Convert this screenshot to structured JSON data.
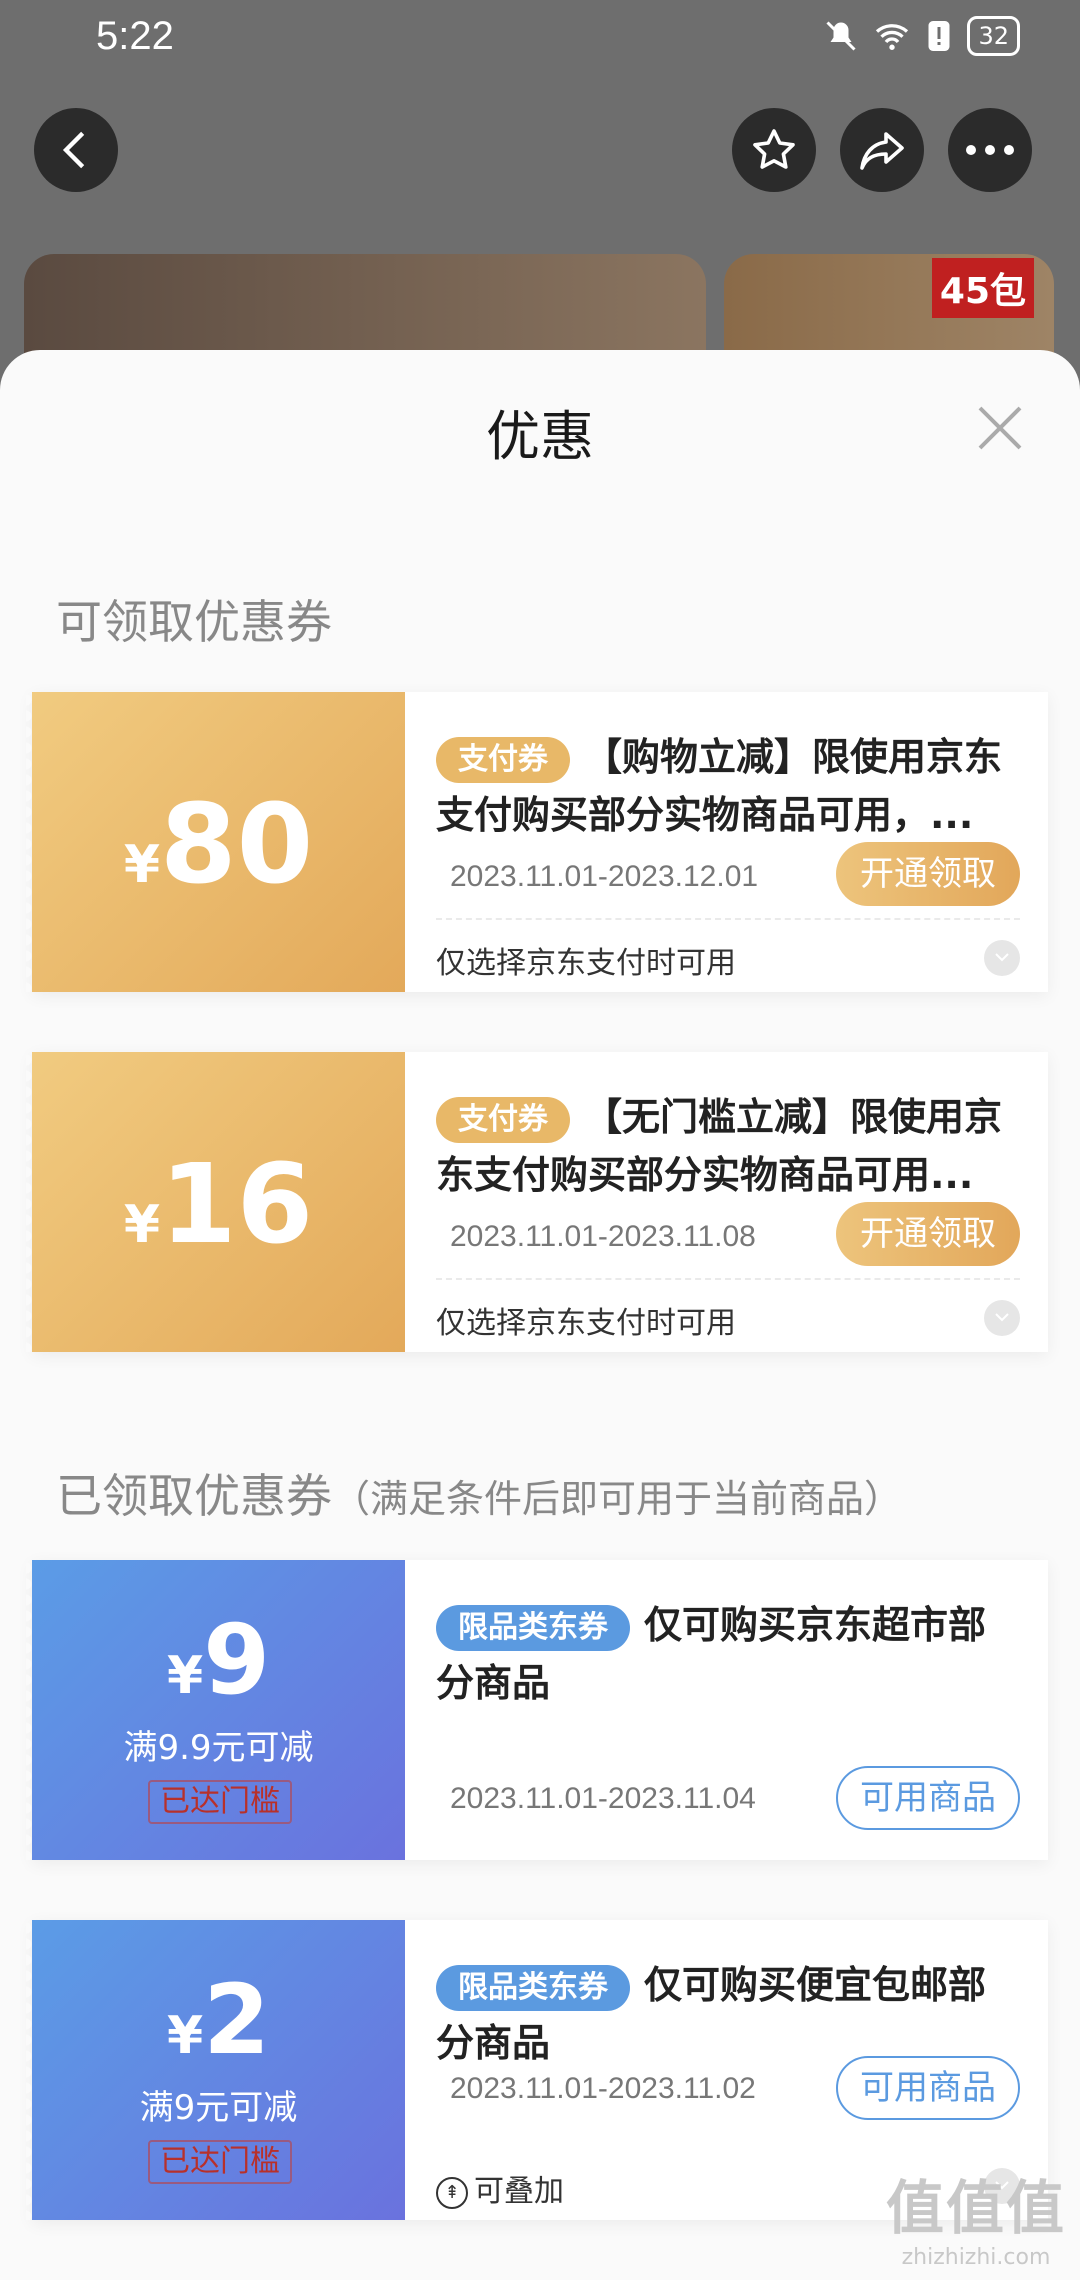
{
  "status_bar": {
    "time": "5:22",
    "battery": "32"
  },
  "preview": {
    "badge": "45包"
  },
  "sheet": {
    "title": "优惠"
  },
  "available": {
    "heading": "可领取优惠券",
    "coupons": [
      {
        "currency": "¥",
        "amount": "80",
        "badge": "支付券",
        "title": "【购物立减】限使用京东支付购买部分实物商品可用，...",
        "date": "2023.11.01-2023.12.01",
        "button": "开通领取",
        "note": "仅选择京东支付时可用"
      },
      {
        "currency": "¥",
        "amount": "16",
        "badge": "支付券",
        "title": "【无门槛立减】限使用京东支付购买部分实物商品可用...",
        "date": "2023.11.01-2023.11.08",
        "button": "开通领取",
        "note": "仅选择京东支付时可用"
      }
    ]
  },
  "claimed": {
    "heading": "已领取优惠券",
    "subheading": "（满足条件后即可用于当前商品）",
    "coupons": [
      {
        "currency": "¥",
        "amount": "9",
        "condition": "满9.9元可减",
        "reached": "已达门槛",
        "badge": "限品类东券",
        "title": "仅可购买京东超市部分商品",
        "date": "2023.11.01-2023.11.04",
        "button": "可用商品"
      },
      {
        "currency": "¥",
        "amount": "2",
        "condition": "满9元可减",
        "reached": "已达门槛",
        "badge": "限品类东券",
        "title": "仅可购买便宜包邮部分商品",
        "date": "2023.11.01-2023.11.02",
        "button": "可用商品",
        "note": "可叠加"
      }
    ]
  },
  "watermark": {
    "main": "值值值",
    "domain": "zhizhizhi.com"
  },
  "colors": {
    "gold": "#e3a95a",
    "blue": "#5b9ae0"
  }
}
